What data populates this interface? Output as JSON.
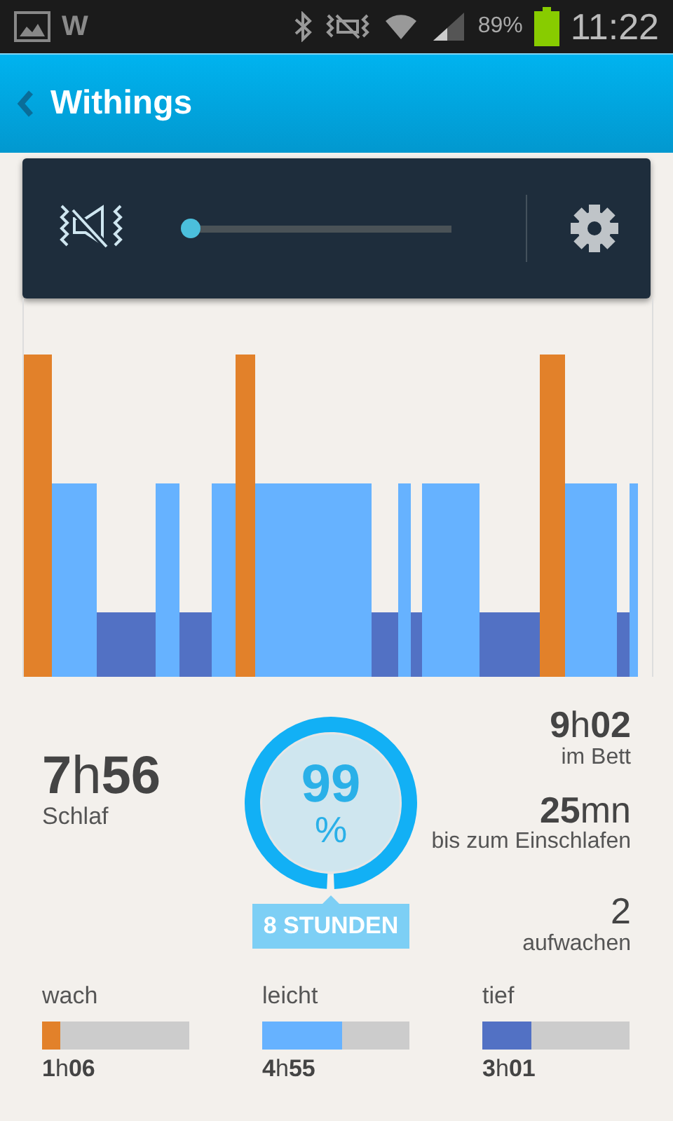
{
  "status_bar": {
    "app_letter": "W",
    "battery": "89%",
    "time": "11:22"
  },
  "app_bar": {
    "title": "Withings"
  },
  "sound_panel": {
    "slider": {
      "level": 0.0
    }
  },
  "summary": {
    "sleep": {
      "value": "**7**h**56**",
      "label": "Schlaf"
    },
    "score": {
      "value": "99",
      "unit": "%",
      "goal": "8 STUNDEN"
    },
    "details": [
      {
        "value": "**9**h**02**",
        "label": "im Bett"
      },
      {
        "value": "**25**mn",
        "label": "bis zum Einschlafen"
      },
      {
        "value": "2",
        "label": "aufwachen"
      }
    ]
  },
  "phases": [
    {
      "label": "wach",
      "color": "#e2812a",
      "level": 0.12,
      "value": "**1**h**06**"
    },
    {
      "label": "leicht",
      "color": "#66b2ff",
      "level": 0.54,
      "value": "**4**h**55**"
    },
    {
      "label": "tief",
      "color": "#5271c4",
      "level": 0.33,
      "value": "**3**h**01**"
    }
  ]
}
